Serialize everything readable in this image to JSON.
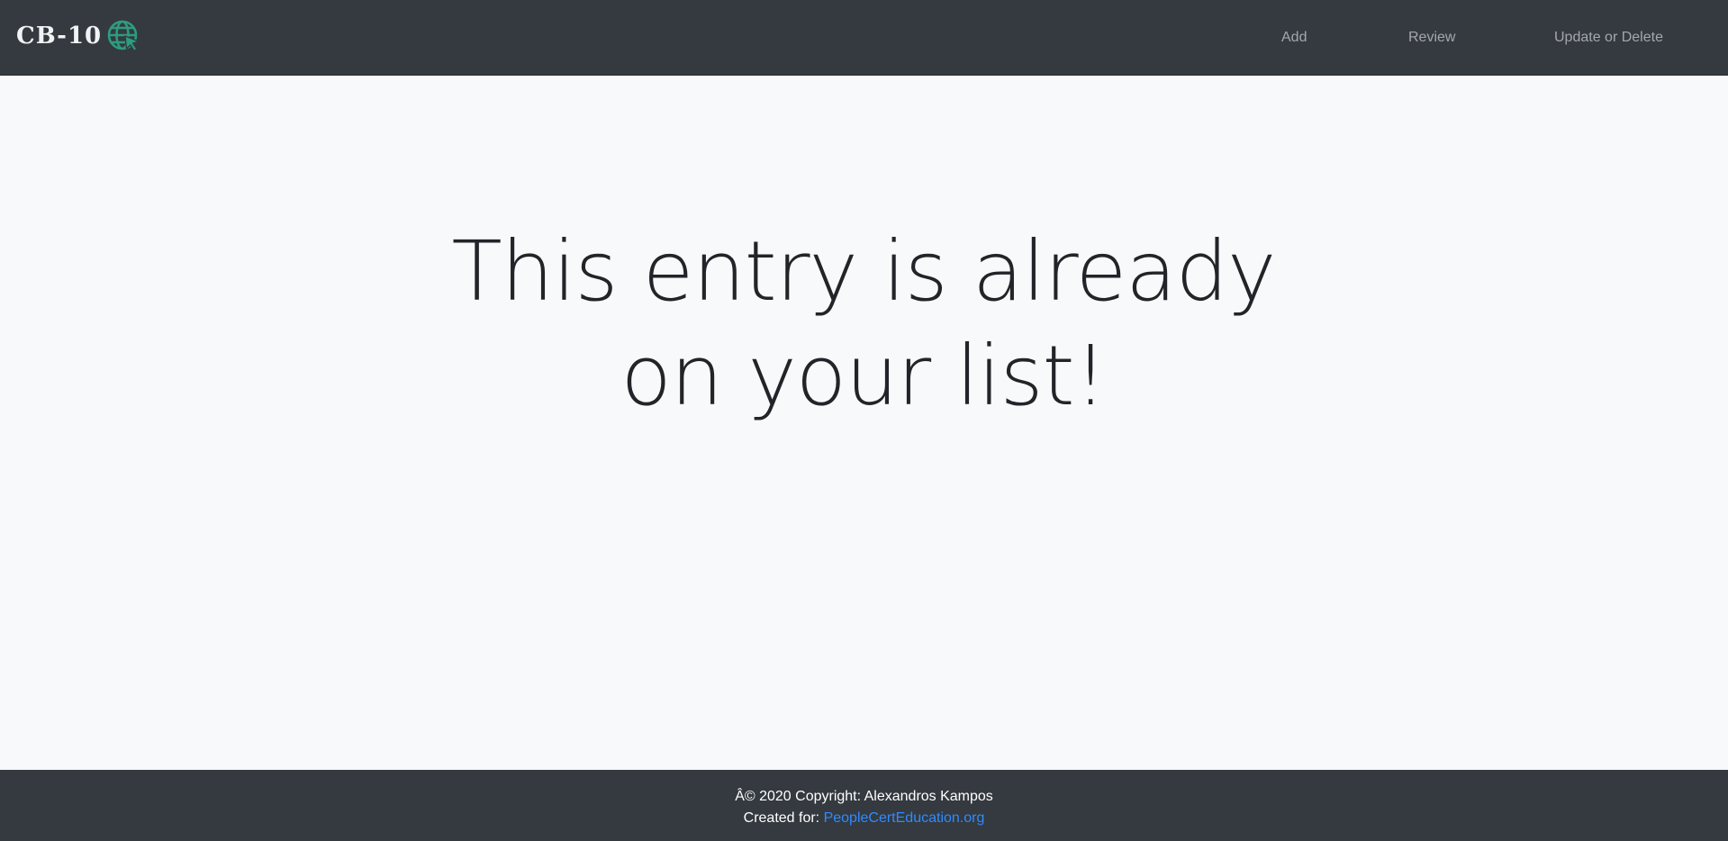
{
  "navbar": {
    "brand": "CB-10",
    "brand_icon": "globe-cursor-icon",
    "brand_icon_color": "#2d9c80",
    "links": {
      "add": "Add",
      "review": "Review",
      "update_delete": "Update or Delete"
    }
  },
  "main": {
    "message": "This entry is already on your list!"
  },
  "footer": {
    "copyright": "Â© 2020 Copyright: Alexandros Kampos",
    "created_for_label": "Created for:",
    "created_for_link": "PeopleCertEducation.org",
    "link_color": "#2f8bff"
  }
}
